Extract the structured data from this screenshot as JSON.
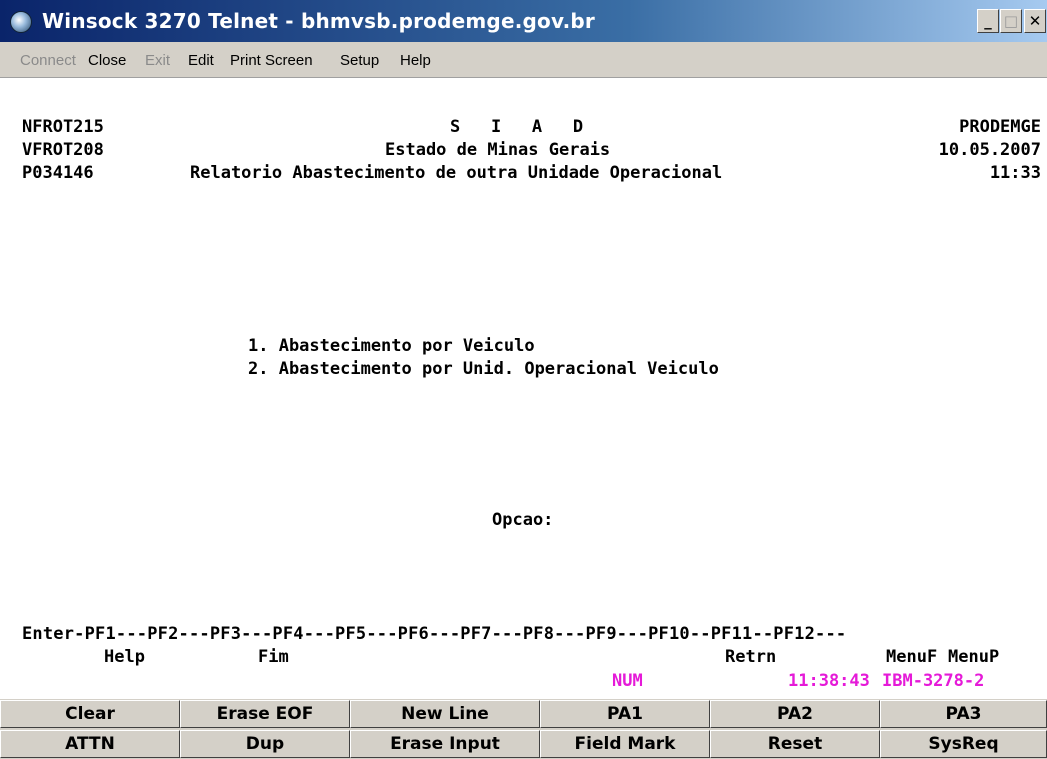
{
  "window": {
    "title": "Winsock 3270 Telnet - bhmvsb.prodemge.gov.br",
    "controls": {
      "minimize": "_",
      "maximize": "□",
      "close": "✕"
    }
  },
  "menu": [
    {
      "label": "Connect",
      "enabled": false
    },
    {
      "label": "Close",
      "enabled": true
    },
    {
      "label": "Exit",
      "enabled": false
    },
    {
      "label": "Edit",
      "enabled": true
    },
    {
      "label": "Print Screen",
      "enabled": true
    },
    {
      "label": "Setup",
      "enabled": true
    },
    {
      "label": "Help",
      "enabled": true
    }
  ],
  "screen": {
    "header": {
      "ids": [
        "NFROT215",
        "VFROT208",
        "P034146"
      ],
      "system": "S   I   A   D",
      "state": "Estado de Minas Gerais",
      "report": "Relatorio Abastecimento de outra Unidade Operacional",
      "org": "PRODEMGE",
      "date": "10.05.2007",
      "time": "11:33"
    },
    "options": [
      "1. Abastecimento por Veiculo",
      "2. Abastecimento por Unid. Operacional Veiculo"
    ],
    "prompt": "Opcao:",
    "pf_line": "Enter-PF1---PF2---PF3---PF4---PF5---PF6---PF7---PF8---PF9---PF10--PF11--PF12---",
    "pf_labels": {
      "pf1": "Help",
      "pf3": "Fim",
      "pf9": "Retrn",
      "pf11": "MenuF",
      "pf12": "MenuP"
    },
    "status": {
      "num": "NUM",
      "clock": "11:38:43",
      "terminal": "IBM-3278-2"
    }
  },
  "keypad": {
    "row1": [
      "Clear",
      "Erase EOF",
      "New Line",
      "PA1",
      "PA2",
      "PA3"
    ],
    "row2": [
      "ATTN",
      "Dup",
      "Erase Input",
      "Field Mark",
      "Reset",
      "SysReq"
    ]
  }
}
